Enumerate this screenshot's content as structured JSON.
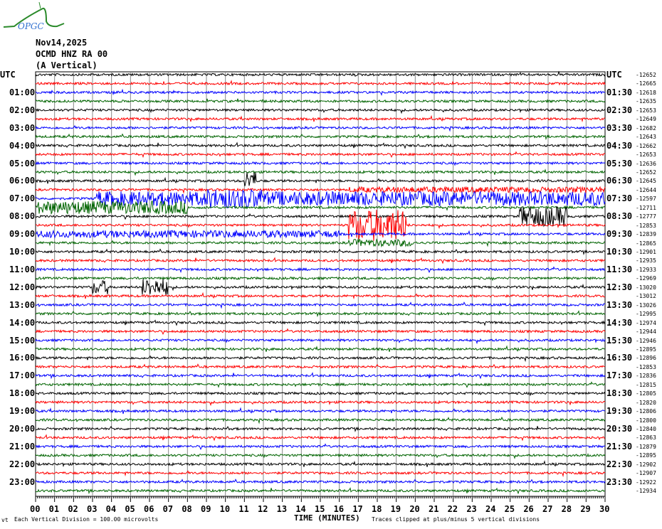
{
  "header": {
    "logo_text": "OPGC",
    "date": "Nov14,2025",
    "station": "OCMD HNZ RA 00",
    "component": "(A Vertical)"
  },
  "footer": {
    "division": "Each Vertical Division =  100.00 microvolts",
    "xlabel": "TIME (MINUTES)",
    "clip_note": "Traces clipped at plus/minus 5 vertical divisions",
    "corner": "vt"
  },
  "chart_data": {
    "type": "line",
    "title": "OCMD HNZ RA 00 (A Vertical) Nov14,2025",
    "xlabel": "TIME (MINUTES)",
    "xlim": [
      0,
      30
    ],
    "x_ticks": [
      "00",
      "01",
      "02",
      "03",
      "04",
      "05",
      "06",
      "07",
      "08",
      "09",
      "10",
      "11",
      "12",
      "13",
      "14",
      "15",
      "16",
      "17",
      "18",
      "19",
      "20",
      "21",
      "22",
      "23",
      "24",
      "25",
      "26",
      "27",
      "28",
      "29",
      "30"
    ],
    "left_labels": [
      "UTC",
      "01:00",
      "02:00",
      "03:00",
      "04:00",
      "05:00",
      "06:00",
      "07:00",
      "08:00",
      "09:00",
      "10:00",
      "11:00",
      "12:00",
      "13:00",
      "14:00",
      "15:00",
      "16:00",
      "17:00",
      "18:00",
      "19:00",
      "20:00",
      "21:00",
      "22:00",
      "23:00"
    ],
    "right_labels": [
      "UTC",
      "01:30",
      "02:30",
      "03:30",
      "04:30",
      "05:30",
      "06:30",
      "07:30",
      "08:30",
      "09:30",
      "10:30",
      "11:30",
      "12:30",
      "13:30",
      "14:30",
      "15:30",
      "16:30",
      "17:30",
      "18:30",
      "19:30",
      "20:30",
      "21:30",
      "22:30",
      "23:30"
    ],
    "trace_offsets": [
      -12652,
      -12665,
      -12618,
      -12635,
      -12653,
      -12649,
      -12682,
      -12643,
      -12662,
      -12653,
      -12636,
      -12652,
      -12645,
      -12644,
      -12597,
      -12711,
      -12777,
      -12853,
      -12839,
      -12865,
      -12901,
      -12935,
      -12933,
      -12969,
      -13020,
      -13012,
      -13026,
      -12995,
      -12974,
      -12944,
      -12946,
      -12895,
      -12896,
      -12853,
      -12836,
      -12815,
      -12805,
      -12820,
      -12806,
      -12800,
      -12840,
      -12863,
      -12879,
      -12895,
      -12902,
      -12907,
      -12922,
      -12934
    ],
    "trace_colors": [
      "#000000",
      "#ff0000",
      "#0000ff",
      "#006400"
    ],
    "events": [
      {
        "row": 14,
        "start": 3.2,
        "end": 30,
        "amp": 10
      },
      {
        "row": 13,
        "start": 16.5,
        "end": 30,
        "amp": 4
      },
      {
        "row": 15,
        "start": 0,
        "end": 8,
        "amp": 9
      },
      {
        "row": 14,
        "start": 9,
        "end": 12,
        "amp": 14
      },
      {
        "row": 12,
        "start": 11,
        "end": 11.6,
        "amp": 14
      },
      {
        "row": 17,
        "start": 16.5,
        "end": 19.5,
        "amp": 22
      },
      {
        "row": 16,
        "start": 25.5,
        "end": 28,
        "amp": 14
      },
      {
        "row": 18,
        "start": 0,
        "end": 16,
        "amp": 5
      },
      {
        "row": 24,
        "start": 3,
        "end": 3.8,
        "amp": 10
      },
      {
        "row": 24,
        "start": 5.6,
        "end": 7,
        "amp": 12
      },
      {
        "row": 19,
        "start": 16.5,
        "end": 20,
        "amp": 5
      }
    ]
  }
}
